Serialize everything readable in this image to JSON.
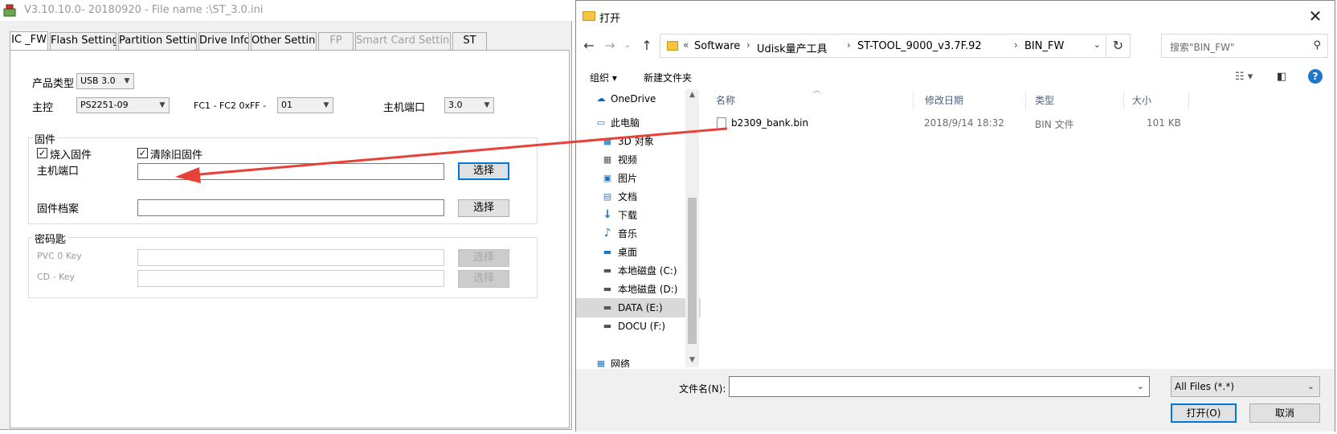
{
  "app": {
    "title": "V3.10.10.0- 20180920 - File name :\\ST_3.0.ini",
    "tabs": [
      {
        "label": "IC _FW",
        "state": "active"
      },
      {
        "label": "Flash Setting",
        "state": "normal"
      },
      {
        "label": "Partition Setting",
        "state": "normal"
      },
      {
        "label": "Drive Info",
        "state": "normal"
      },
      {
        "label": "Other Setting",
        "state": "normal"
      },
      {
        "label": "FP",
        "state": "disabled"
      },
      {
        "label": "Smart Card Setting",
        "state": "disabled"
      },
      {
        "label": "ST",
        "state": "normal"
      }
    ],
    "product_type_label": "产品类型",
    "product_type_value": "USB 3.0",
    "controller_label": "主控",
    "controller_value": "PS2251-09",
    "fc_label": "FC1 - FC2   0xFF -",
    "fc_value": "01",
    "host_port_label": "主机端口",
    "host_port_value": "3.0",
    "firmware_group": {
      "title": "固件",
      "burn_fw_label": "烧入固件",
      "burn_fw_checked": true,
      "clear_fw_label": "清除旧固件",
      "clear_fw_checked": true,
      "host_port_label": "主机端口",
      "host_port_path": "",
      "select_label": "选择",
      "fw_file_label": "固件档案",
      "fw_file_path": "",
      "select2_label": "选择"
    },
    "key_group": {
      "title": "密码匙",
      "pvc_label": "PVC 0 Key",
      "cd_label": "CD - Key",
      "select_label": "选择",
      "select2_label": "选择"
    }
  },
  "dialog": {
    "title": "打开",
    "close_glyph": "✕",
    "breadcrumb": [
      "«",
      "Software",
      "Udisk量产工具",
      "ST-TOOL_9000_v3.7F.92",
      "BIN_FW"
    ],
    "search_placeholder": "搜索\"BIN_FW\"",
    "organize_label": "组织 ▾",
    "new_folder_label": "新建文件夹",
    "columns": [
      "名称",
      "修改日期",
      "类型",
      "大小"
    ],
    "files": [
      {
        "name": "b2309_bank.bin",
        "modified": "2018/9/14 18:32",
        "type": "BIN 文件",
        "size": "101 KB"
      }
    ],
    "nav_items": [
      {
        "label": "OneDrive",
        "icon": "cloud-icon",
        "glyph": "☁",
        "color": "#0a64c8",
        "selected": false
      },
      {
        "label": "此电脑",
        "icon": "computer-icon",
        "glyph": "▭",
        "color": "#1e78c8",
        "selected": false
      },
      {
        "label": "3D 对象",
        "icon": "cube-icon",
        "glyph": "■",
        "color": "#3aa0d8",
        "selected": false
      },
      {
        "label": "视频",
        "icon": "film-icon",
        "glyph": "▦",
        "color": "#555555",
        "selected": false
      },
      {
        "label": "图片",
        "icon": "picture-icon",
        "glyph": "▣",
        "color": "#2a6fb0",
        "selected": false
      },
      {
        "label": "文档",
        "icon": "document-icon",
        "glyph": "▤",
        "color": "#4a7fb5",
        "selected": false
      },
      {
        "label": "下载",
        "icon": "download-icon",
        "glyph": "↓",
        "color": "#1e78c8",
        "selected": false
      },
      {
        "label": "音乐",
        "icon": "music-icon",
        "glyph": "♪",
        "color": "#1e78c8",
        "selected": false
      },
      {
        "label": "桌面",
        "icon": "desktop-icon",
        "glyph": "▬",
        "color": "#1e78c8",
        "selected": false
      },
      {
        "label": "本地磁盘 (C:)",
        "icon": "drive-c-icon",
        "glyph": "▬",
        "color": "#555555",
        "selected": false
      },
      {
        "label": "本地磁盘 (D:)",
        "icon": "drive-d-icon",
        "glyph": "▬",
        "color": "#555555",
        "selected": false
      },
      {
        "label": "DATA (E:)",
        "icon": "drive-e-icon",
        "glyph": "▬",
        "color": "#555555",
        "selected": true
      },
      {
        "label": "DOCU (F:)",
        "icon": "drive-f-icon",
        "glyph": "▬",
        "color": "#555555",
        "selected": false
      },
      {
        "label": "网络",
        "icon": "network-icon",
        "glyph": "▦",
        "color": "#1e78c8",
        "selected": false
      }
    ],
    "filename_label": "文件名(N):",
    "filename_value": "",
    "filter_value": "All Files (*.*)",
    "open_label": "打开(O)",
    "cancel_label": "取消"
  },
  "colors": {
    "accent": "#0078d7",
    "annotation_arrow": "#e8413a"
  }
}
